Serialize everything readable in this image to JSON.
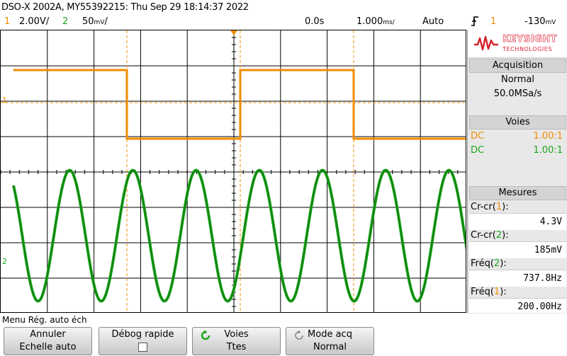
{
  "header": {
    "title": "DSO-X 2002A, MY55392215: Thu Sep 29 18:14:37 2022"
  },
  "status": {
    "ch1_num": "1",
    "ch1_scale": "2.00V/",
    "ch2_num": "2",
    "ch2_scale": "50",
    "ch2_unit_glyph": "mV",
    "time_offset": "0.0s",
    "time_scale": "1.000",
    "time_unit_glyph": "ms/",
    "trigger_mode": "Auto",
    "trigger_edge_icon": "rising-edge-icon",
    "trigger_source": "1",
    "trigger_level": "-130",
    "trigger_level_unit_glyph": "mV"
  },
  "colors": {
    "ch1": "#f08c00",
    "ch2": "#1aa51a",
    "grid": "#000000",
    "background": "#ffffff"
  },
  "panel": {
    "logo_brand": "KEYSIGHT",
    "logo_sub": "TECHNOLOGIES",
    "acq_title": "Acquisition",
    "acq_mode": "Normal",
    "acq_rate": "50.0MSa/s",
    "voies_title": "Voies",
    "ch1_coupling": "DC",
    "ch1_probe": "1.00:1",
    "ch2_coupling": "DC",
    "ch2_probe": "1.00:1",
    "mesures_title": "Mesures",
    "measurements": [
      {
        "label": "Cr-cr(",
        "ch": "1",
        "label_end": "):",
        "value": "4.3V"
      },
      {
        "label": "Cr-cr(",
        "ch": "2",
        "label_end": "):",
        "value": "185mV"
      },
      {
        "label": "Fréq(",
        "ch": "2",
        "label_end": "):",
        "value": "737.8Hz"
      },
      {
        "label": "Fréq(",
        "ch": "1",
        "label_end": "):",
        "value": "200.00Hz"
      }
    ]
  },
  "menu": {
    "title": "Menu Rég. auto éch",
    "softkeys": [
      {
        "line1": "Annuler",
        "line2": "Echelle auto"
      },
      {
        "line1": "Débog rapide",
        "line2": ""
      },
      {
        "line1": "Voies",
        "line2": "Ttes"
      },
      {
        "line1": "Mode acq",
        "line2": "Normal"
      }
    ]
  },
  "markers": {
    "ch1_ground": "1",
    "ch2_ground": "2"
  }
}
